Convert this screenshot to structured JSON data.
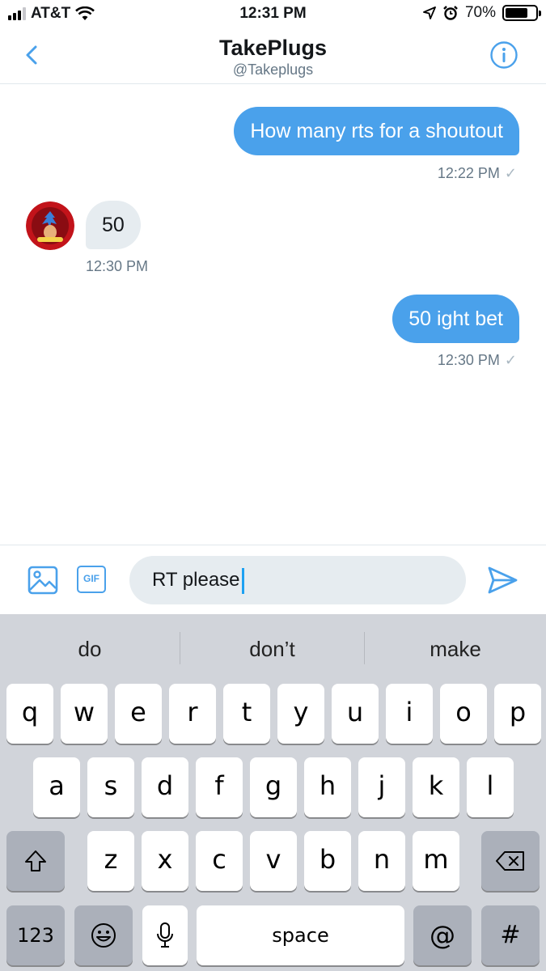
{
  "status_bar": {
    "carrier": "AT&T",
    "time": "12:31 PM",
    "battery_percent": "70%",
    "battery_level": 0.7,
    "icons": [
      "signal-icon",
      "wifi-icon",
      "location-icon",
      "alarm-icon",
      "battery-icon"
    ]
  },
  "header": {
    "title": "TakePlugs",
    "handle": "@Takeplugs",
    "back_icon": "chevron-left-icon",
    "info_icon": "info-icon"
  },
  "messages": [
    {
      "direction": "outgoing",
      "text": "How many rts for a shoutout",
      "time": "12:22 PM",
      "status": "✓"
    },
    {
      "direction": "incoming",
      "text": "50",
      "time": "12:30 PM"
    },
    {
      "direction": "outgoing",
      "text": "50 ight bet",
      "time": "12:30 PM",
      "status": "✓"
    }
  ],
  "composer": {
    "media_icon": "image-icon",
    "gif_label": "GIF",
    "input_value": "RT please",
    "send_icon": "send-icon"
  },
  "keyboard": {
    "suggestions": [
      "do",
      "don’t",
      "make"
    ],
    "row1": [
      "q",
      "w",
      "e",
      "r",
      "t",
      "y",
      "u",
      "i",
      "o",
      "p"
    ],
    "row2": [
      "a",
      "s",
      "d",
      "f",
      "g",
      "h",
      "j",
      "k",
      "l"
    ],
    "row3": [
      "z",
      "x",
      "c",
      "v",
      "b",
      "n",
      "m"
    ],
    "numbers_label": "123",
    "space_label": "space",
    "at_label": "@",
    "hash_label": "#"
  },
  "colors": {
    "accent": "#4aa1eb",
    "incoming_bubble": "#e6ecf0",
    "keyboard_bg": "#d1d4da"
  }
}
